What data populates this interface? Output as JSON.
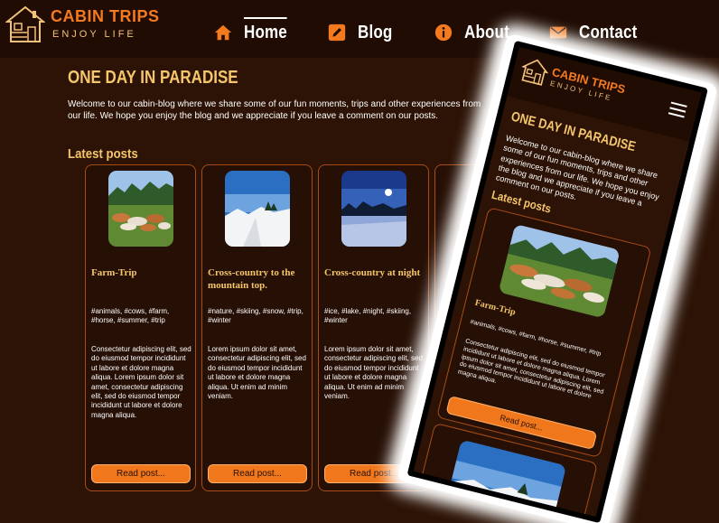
{
  "brand": {
    "title": "CABIN TRIPS",
    "subtitle": "ENJOY LIFE"
  },
  "nav": [
    {
      "label": "Home",
      "icon": "home-icon",
      "active": true
    },
    {
      "label": "Blog",
      "icon": "edit-icon"
    },
    {
      "label": "About",
      "icon": "info-icon"
    },
    {
      "label": "Contact",
      "icon": "envelope-icon"
    }
  ],
  "colors": {
    "accent": "#f47a1f",
    "heading": "#f5c66a",
    "background": "#2c1306",
    "header": "#200c03"
  },
  "main": {
    "title": "ONE DAY IN PARADISE",
    "intro": "Welcome to our cabin-blog where we share some of our fun moments, trips and other experiences from our life. We hope you enjoy the blog and we appreciate if you leave a comment on our posts.",
    "latest": "Latest posts"
  },
  "posts": [
    {
      "title": "Farm-Trip",
      "tags": "#animals, #cows, #farm, #horse, #summer, #trip",
      "body": "Consectetur adipiscing elit, sed do eiusmod tempor incididunt ut labore et dolore magna aliqua. Lorem ipsum dolor sit amet, consectetur adipiscing elit, sed do eiusmod tempor incididunt ut labore et dolore magna aliqua.",
      "button": "Read post..."
    },
    {
      "title": "Cross-country to the mountain top.",
      "tags": "#nature, #skiing, #snow, #trip, #winter",
      "body": "Lorem ipsum dolor sit amet, consectetur adipiscing elit, sed do eiusmod tempor incididunt ut labore et dolore magna aliqua. Ut enim ad minim veniam.",
      "button": "Read post..."
    },
    {
      "title": "Cross-country at night",
      "tags": "#ice, #lake, #night, #skiing, #winter",
      "body": "Lorem ipsum dolor sit amet, consectetur adipiscing elit, sed do eiusmod tempor incididunt ut labore et dolore magna aliqua. Ut enim ad minim veniam.",
      "button": "Read post..."
    }
  ],
  "mobile": {
    "card": {
      "title": "Farm-Trip",
      "tags": "#animals, #cows, #farm, #horse, #summer, #trip",
      "body": "Consectetur adipiscing elit, sed do eiusmod tempor incididunt ut labore et dolore magna aliqua. Lorem ipsum dolor sit amet, consectetur adipiscing elit, sed do eiusmod tempor incididunt ut labore et dolore magna aliqua.",
      "button": "Read post..."
    }
  }
}
